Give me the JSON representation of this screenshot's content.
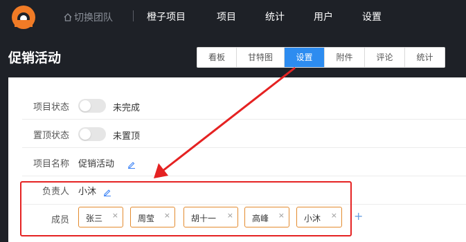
{
  "header": {
    "team_label": "切换团队",
    "nav": [
      "橙子项目",
      "项目",
      "统计",
      "用户",
      "设置"
    ]
  },
  "page": {
    "title": "促销活动",
    "tabs": [
      "看板",
      "甘特图",
      "设置",
      "附件",
      "评论",
      "统计"
    ],
    "active_tab": "设置"
  },
  "settings": {
    "status_label": "项目状态",
    "status_value": "未完成",
    "pin_label": "置顶状态",
    "pin_value": "未置顶",
    "name_label": "项目名称",
    "name_value": "促销活动",
    "owner_label": "负责人",
    "owner_value": "小沐",
    "members_label": "成员",
    "members": [
      "张三",
      "周莹",
      "胡十一",
      "高峰",
      "小沐"
    ],
    "remove_glyph": "×",
    "add_glyph": "+"
  },
  "colors": {
    "accent": "#2d8cf0",
    "tag_border": "#e38a2d",
    "annotation": "#e52222",
    "topbar": "#1e2127"
  }
}
